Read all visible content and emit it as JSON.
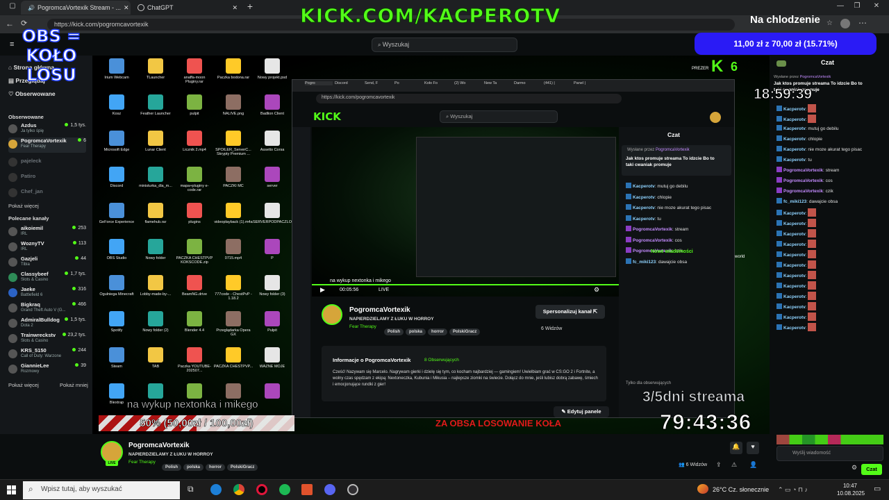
{
  "browser": {
    "tabs": [
      {
        "label": "PogromcaVortexik Stream - ...",
        "active": true
      },
      {
        "label": "ChatGPT",
        "active": false
      }
    ],
    "url": "https://kick.com/pogromcavortexik"
  },
  "kick": {
    "search_placeholder": "Wyszukaj",
    "nav": [
      "Strona główna",
      "Przeglądaj",
      "Obserwowane"
    ],
    "followed_title": "Obserwowane",
    "followed": [
      {
        "name": "Azdus",
        "game": "Ja tylko śpię",
        "viewers": "1,5 tys."
      },
      {
        "name": "PogromcaVortexik",
        "game": "Fear Therapy",
        "viewers": "6"
      },
      {
        "name": "pajeleck",
        "game": "",
        "viewers": ""
      },
      {
        "name": "Patiro",
        "game": "",
        "viewers": ""
      },
      {
        "name": "Chef_jan",
        "game": "",
        "viewers": ""
      }
    ],
    "show_more": "Pokaż więcej",
    "recommended_title": "Polecane kanały",
    "recommended": [
      {
        "name": "aikoiemil",
        "game": "IRL",
        "viewers": "253"
      },
      {
        "name": "WoznyTV",
        "game": "IRL",
        "viewers": "113"
      },
      {
        "name": "Gazjeli",
        "game": "Tibia",
        "viewers": "44"
      },
      {
        "name": "Classybeef",
        "game": "Slots & Casino",
        "viewers": "1,7 tys."
      },
      {
        "name": "Jaeke",
        "game": "Battlefield 6",
        "viewers": "316"
      },
      {
        "name": "Bigkraq",
        "game": "Grand Theft Auto V (G...",
        "viewers": "466"
      },
      {
        "name": "AdmiralBulldog",
        "game": "Dota 2",
        "viewers": "1,5 tys."
      },
      {
        "name": "Trainwreckstv",
        "game": "Slots & Casino",
        "viewers": "23,2 tys."
      },
      {
        "name": "KRS_5150",
        "game": "Call of Duty: Warzone",
        "viewers": "244"
      },
      {
        "name": "GiannieLee",
        "game": "Rozmowy",
        "viewers": "39"
      }
    ],
    "show_more2": "Pokaż więcej",
    "show_less": "Pokaż mniej"
  },
  "desktop_icons": [
    "Irium Webcam",
    "TLauncher",
    "anaffa-moon Pluginy.rar",
    "Paczka bodona.rar",
    "Nowy projekt.psd",
    "Kosz",
    "Feather Launcher",
    "pulpit",
    "NALIVE.png",
    "Badlion Client",
    "Microsoft Edge",
    "Lunar Client",
    "Licznik 2.mp4",
    "SPOILER_ServerC... Skrypty Premium ...",
    "Assetto Corsa",
    "Discord",
    "ministurka_dla_m...",
    "mapa+pluginy e-code.rar",
    "PACZKI MC",
    "server",
    "GeForce Experience",
    "flamehub.rar",
    "plugins",
    "videoplayback (1).m4a",
    "SERVERPODPACZLO",
    "OBS Studio",
    "Nowy folder",
    "PACZKA CHESTPVP KOKSCODE.zip",
    "0715.mp4",
    "P",
    "Ogulniega Minecraft",
    "Lobby-made-by-...",
    "BeamNG.drive",
    "777code - ChestPvP - 1.18.2",
    "Nowy folder (3)",
    "Spotify",
    "Nowy folder (2)",
    "Blender 4.4",
    "Przeglądarka Opera GX",
    "Pulpit",
    "Steam",
    "TAB",
    "Paczka YOUTUBE-202507...",
    "PACZKA CHESTPVP...",
    "WAZNE MOJE",
    "Blextrap",
    "",
    "",
    "",
    ""
  ],
  "desktop_extra": {
    "prezer": "PREZER",
    "world": "world"
  },
  "inner_browser": {
    "url": "https://kick.com/pogromcavortexik",
    "tabs": [
      "Pogro",
      "Discord",
      "Send, F",
      "Po",
      "Koło Fo",
      "(2) Wo",
      "New Ta",
      "Darmo",
      "(441) |",
      "Panel |"
    ],
    "search": "Wyszukaj",
    "channel_name": "PogromcaVortexik",
    "stream_title": "NAPIERDZIELAMY Z ŁUKU W HORROY",
    "category": "Fear Therapy",
    "tags": [
      "Polish",
      "polska",
      "horror",
      "PolskiGracz"
    ],
    "customize": "Spersonalizuj kanał",
    "viewers": "6 Widzów",
    "about_title": "Informacje o PogromcaVortexik",
    "followers": "8 Obserwujących",
    "about_text": "Cześć! Nazywam się Marcelo. Nagrywam gierki i dzielę się tym, co kocham najbardziej — gamingiem! Uwielbiam grać w CS:GO 2 i Fortnite, a wolny czas spędzam z ekipą: Nextoneczka, Kubunia i Mikusia – najlepsze ziomki na świecie. Dołącz do mnie, jeśli lubisz dobrą zabawę, śmiech i emocjonujące rundki z gier!",
    "edit_panel": "Edytuj panele",
    "live_label": "LIVE",
    "player_time": "00:05:56",
    "player_caption": "na wykup nextonka i mikego",
    "chat_title": "Czat",
    "pinned_by": "Wysłane przez",
    "pinned_user": "PogromcaVortexik",
    "pinned_text": "Jak ktos promuje streama To idzcie Bo to taki cwaniak promuje",
    "new_messages": "Nowe wiadomości",
    "subs_only": "Tylko dla obserwujących",
    "messages": [
      {
        "user": "Kacperotv",
        "text": "mutuj go debilu"
      },
      {
        "user": "Kacperotv",
        "text": "chlopie"
      },
      {
        "user": "Kacperotv",
        "text": "nie moze akurat tego pisac"
      },
      {
        "user": "Kacperotv",
        "text": "tu"
      },
      {
        "user": "PogromcaVortexik",
        "text": "stream"
      },
      {
        "user": "PogromcaVortexik",
        "text": "cos"
      },
      {
        "user": "PogromcaVortexik",
        "text": "czik"
      },
      {
        "user": "fc_miki123",
        "text": "dawajcie obsa"
      }
    ]
  },
  "chat": {
    "title": "Czat",
    "pinned_by": "Wysłane przez",
    "pinned_user": "PogromcaVortexik",
    "pinned_text": "Jak ktos promuje streama To idzcie Bo to taki cwaniak promuje",
    "messages": [
      {
        "user": "Kacperotv",
        "text": "",
        "emote": true
      },
      {
        "user": "Kacperotv",
        "text": "",
        "emote": true
      },
      {
        "user": "Kacperotv",
        "text": "mutuj go debilu"
      },
      {
        "user": "Kacperotv",
        "text": "chlopie"
      },
      {
        "user": "Kacperotv",
        "text": "nie moze akurat tego pisac"
      },
      {
        "user": "Kacperotv",
        "text": "tu"
      },
      {
        "user": "PogromcaVortexik",
        "text": "stream"
      },
      {
        "user": "PogromcaVortexik",
        "text": "cos"
      },
      {
        "user": "PogromcaVortexik",
        "text": "czik"
      },
      {
        "user": "fc_miki123",
        "text": "dawajcie obsa"
      },
      {
        "user": "Kacperotv",
        "text": "",
        "emote": true
      },
      {
        "user": "Kacperotv",
        "text": "",
        "emote": true
      },
      {
        "user": "Kacperotv",
        "text": "",
        "emote": true
      },
      {
        "user": "Kacperotv",
        "text": "",
        "emote": true
      },
      {
        "user": "Kacperotv",
        "text": "",
        "emote": true
      },
      {
        "user": "Kacperotv",
        "text": "",
        "emote": true
      },
      {
        "user": "Kacperotv",
        "text": "",
        "emote": true
      },
      {
        "user": "Kacperotv",
        "text": "",
        "emote": true
      },
      {
        "user": "Kacperotv",
        "text": "",
        "emote": true
      },
      {
        "user": "Kacperotv",
        "text": "",
        "emote": true
      },
      {
        "user": "Kacperotv",
        "text": "",
        "emote": true
      },
      {
        "user": "Kacperotv",
        "text": "",
        "emote": true
      }
    ],
    "input_placeholder": "Wyślij wiadomość",
    "send": "Czat"
  },
  "channel": {
    "name": "PogromcaVortexik",
    "title": "NAPIERDZIELAMY Z ŁUKU W HORROY",
    "category": "Fear Therapy",
    "tags": [
      "Polish",
      "polska",
      "horror",
      "PolskiGracz"
    ],
    "viewers": "6 Widzów",
    "live": "LIVE"
  },
  "overlays": {
    "kick_url": "KICK.COM/KACPEROTV",
    "obs_line1": "OBS =",
    "obs_line2": "KOŁO LOSU",
    "cooldown": "Na chlodzenie",
    "donation": "11,00 zł z 70,00 zł (15.71%)",
    "clock": "18:59:39",
    "goal_text": "50% (50,00zł / 100,00zł)",
    "goal_fraction": 0.5,
    "goal_caption": "na wykup nextonka i mikego",
    "obsada": "ZA OBSA LOSOWANIE KOŁA",
    "streama": "3/5dni streama",
    "big_timer": "79:43:36",
    "k6": "6"
  },
  "taskbar": {
    "search_placeholder": "Wpisz tutaj, aby wyszukać",
    "weather": "26°C  Cz. słonecznie",
    "time": "10:47",
    "date": "10.08.2025"
  },
  "colors": {
    "kick_green": "#53fc18",
    "donation_bg": "#2a1bf5",
    "alert_red": "#e01a1a"
  }
}
